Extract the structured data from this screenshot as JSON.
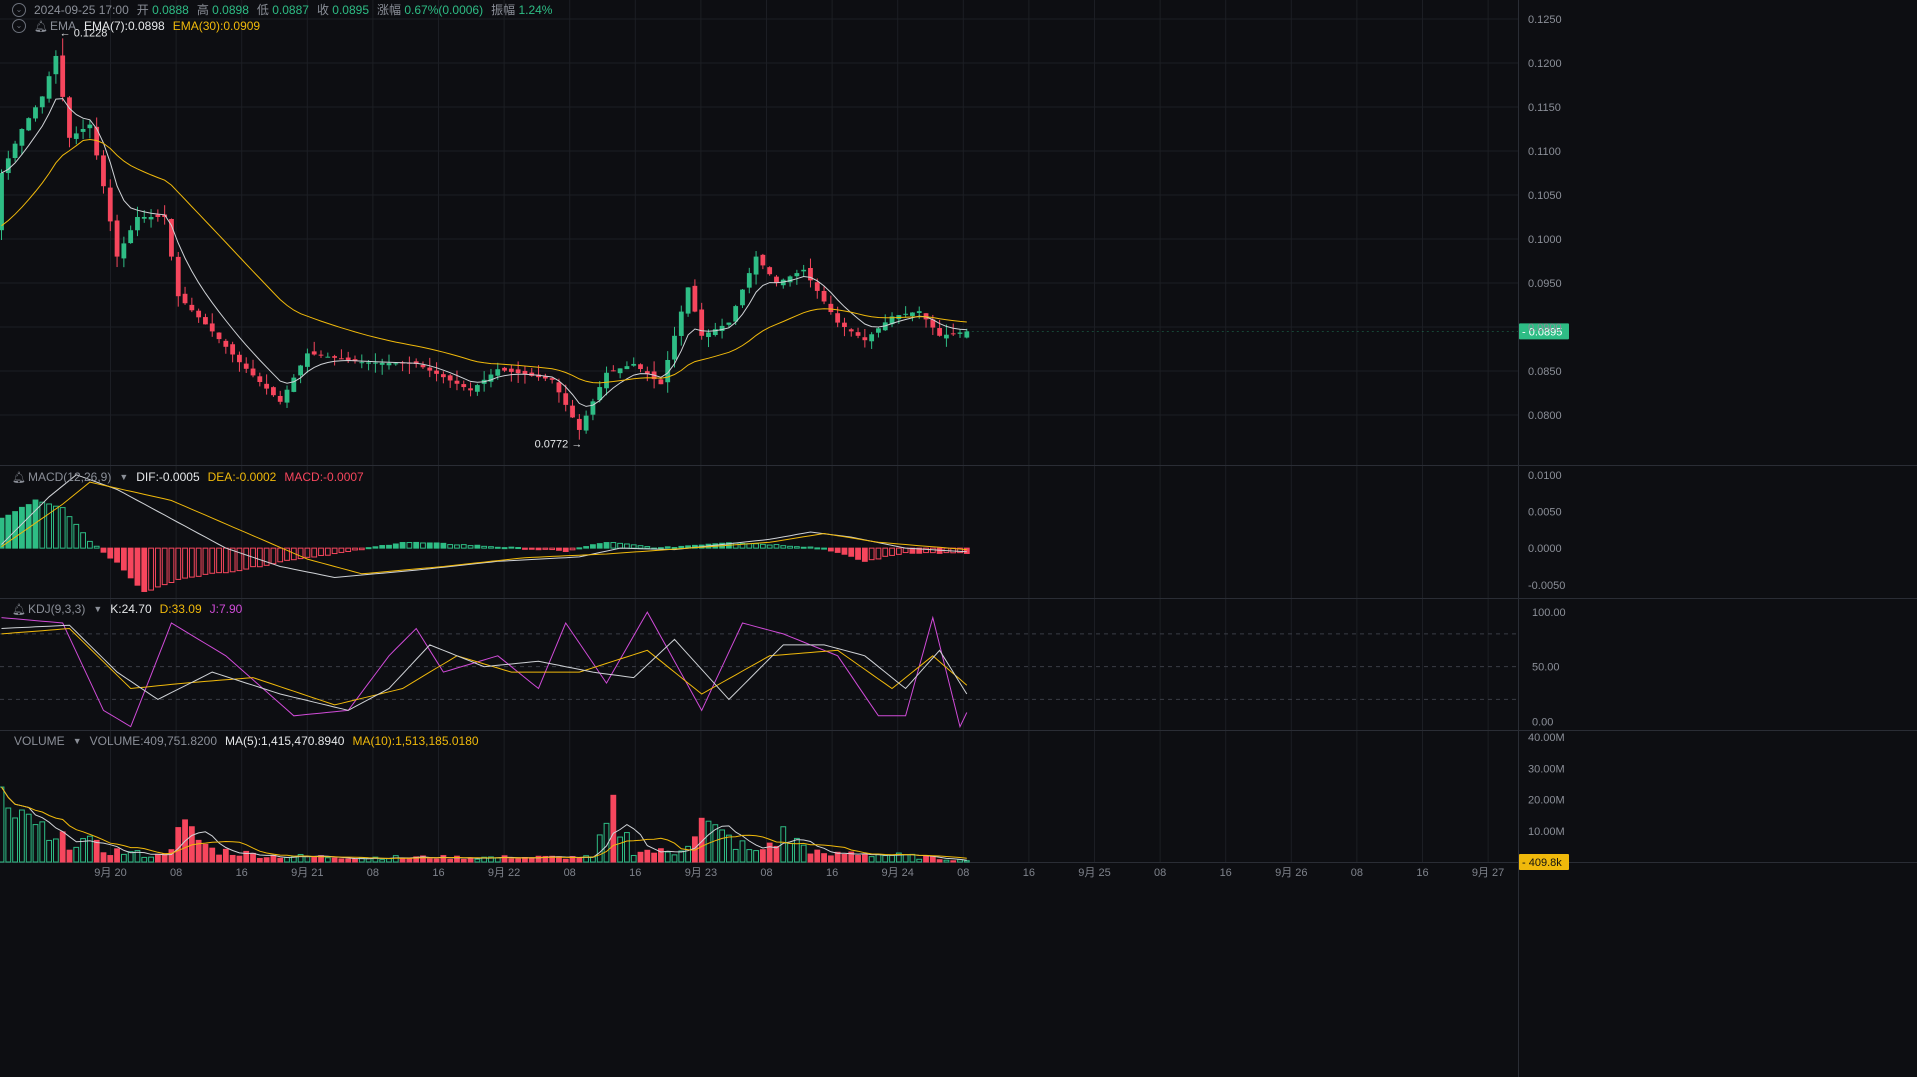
{
  "header": {
    "datetime": "2024-09-25 17:00",
    "open_label": "开",
    "open": "0.0888",
    "high_label": "高",
    "high": "0.0898",
    "low_label": "低",
    "low": "0.0887",
    "close_label": "收",
    "close": "0.0895",
    "change_label": "涨幅",
    "change": "0.67%(0.0006)",
    "amp_label": "振幅",
    "amp": "1.24%"
  },
  "ema_legend": {
    "name": "EMA",
    "ema7": "EMA(7):0.0898",
    "ema30": "EMA(30):0.0909"
  },
  "macd_legend": {
    "name": "MACD(12,26,9)",
    "dif": "DIF:-0.0005",
    "dea": "DEA:-0.0002",
    "macd": "MACD:-0.0007"
  },
  "kdj_legend": {
    "name": "KDJ(9,3,3)",
    "k": "K:24.70",
    "d": "D:33.09",
    "j": "J:7.90"
  },
  "vol_legend": {
    "name": "VOLUME",
    "vol": "VOLUME:409,751.8200",
    "ma5": "MA(5):1,415,470.8940",
    "ma10": "MA(10):1,513,185.0180"
  },
  "colors": {
    "up": "#2ebd85",
    "down": "#f6465d",
    "ema7": "#cfd2d6",
    "ema30": "#f0b90b",
    "j": "#d04bd8",
    "bg": "#0d0e12",
    "grid": "#1c1e24",
    "text": "#8b8f98"
  },
  "chart_data": [
    {
      "type": "candlestick",
      "title": "",
      "price_axis_ticks": [
        "0.1250",
        "0.1200",
        "0.1150",
        "0.1100",
        "0.1050",
        "0.1000",
        "0.0950",
        "0.0900",
        "0.0850",
        "0.0800"
      ],
      "ylim": [
        0.0753,
        0.127
      ],
      "x_axis_labels": [
        "9月 20",
        "08",
        "16",
        "9月 21",
        "08",
        "16",
        "9月 22",
        "08",
        "16",
        "9月 23",
        "08",
        "16",
        "9月 24",
        "08",
        "16",
        "9月 25",
        "08",
        "16",
        "9月 26",
        "08",
        "16",
        "9月 27"
      ],
      "candle_interval_hours": 1,
      "first_candle": "2024-09-19 19:00",
      "last_candle": "2024-09-25 17:00",
      "current_price": "0.0895",
      "max_marker": "← 0.1228",
      "min_marker": "0.0772 →",
      "ohlc_keypoints": [
        [
          "2024-09-19 19:00",
          0.101,
          0.1075
        ],
        [
          "2024-09-19 22:00",
          0.1075,
          0.1125
        ],
        [
          "2024-09-20 01:00",
          0.1125,
          0.1162
        ],
        [
          "2024-09-20 03:00",
          0.116,
          0.1208
        ],
        [
          "2024-09-20 05:00",
          0.1208,
          0.1115
        ],
        [
          "2024-09-20 08:00",
          0.1115,
          0.113
        ],
        [
          "2024-09-20 10:00",
          0.1125,
          0.106
        ],
        [
          "2024-09-20 12:00",
          0.106,
          0.098
        ],
        [
          "2024-09-20 15:00",
          0.099,
          0.1025
        ],
        [
          "2024-09-20 19:00",
          0.102,
          0.1025
        ],
        [
          "2024-09-20 21:00",
          0.1015,
          0.0935
        ],
        [
          "2024-09-21 02:00",
          0.092,
          0.0895
        ],
        [
          "2024-09-21 06:00",
          0.088,
          0.086
        ],
        [
          "2024-09-21 12:00",
          0.088,
          0.0815
        ],
        [
          "2024-09-21 16:00",
          0.086,
          0.087
        ],
        [
          "2024-09-22 00:00",
          0.0865,
          0.086
        ],
        [
          "2024-09-22 08:00",
          0.0862,
          0.0858
        ],
        [
          "2024-09-22 16:00",
          0.0848,
          0.0828
        ],
        [
          "2024-09-22 20:00",
          0.0858,
          0.0852
        ],
        [
          "2024-09-23 04:00",
          0.0846,
          0.084
        ],
        [
          "2024-09-23 08:00",
          0.083,
          0.0783
        ],
        [
          "2024-09-23 12:00",
          0.0835,
          0.0848
        ],
        [
          "2024-09-23 16:00",
          0.088,
          0.0858
        ],
        [
          "2024-09-23 20:00",
          0.0845,
          0.0835
        ],
        [
          "2024-09-24 00:00",
          0.086,
          0.0945
        ],
        [
          "2024-09-24 02:00",
          0.094,
          0.089
        ],
        [
          "2024-09-24 06:00",
          0.091,
          0.0905
        ],
        [
          "2024-09-24 10:00",
          0.0935,
          0.098
        ],
        [
          "2024-09-24 13:00",
          0.097,
          0.095
        ],
        [
          "2024-09-24 17:00",
          0.096,
          0.0965
        ],
        [
          "2024-09-24 22:00",
          0.0935,
          0.0905
        ],
        [
          "2024-09-25 02:00",
          0.088,
          0.0885
        ],
        [
          "2024-09-25 06:00",
          0.0905,
          0.0912
        ],
        [
          "2024-09-25 10:00",
          0.0915,
          0.0918
        ],
        [
          "2024-09-25 13:00",
          0.0905,
          0.089
        ],
        [
          "2024-09-25 17:00",
          0.0888,
          0.0895
        ]
      ],
      "series": [
        {
          "name": "EMA(7)"
        },
        {
          "name": "EMA(30)"
        }
      ]
    },
    {
      "type": "macd",
      "axis_ticks": [
        "0.0100",
        "0.0050",
        "0.0000",
        "-0.0050"
      ],
      "ylim": [
        -0.0068,
        0.0112
      ],
      "dif_keypoints": [
        [
          "2024-09-19 19:00",
          0.0005
        ],
        [
          "2024-09-20 02:00",
          0.007
        ],
        [
          "2024-09-20 06:00",
          0.01
        ],
        [
          "2024-09-20 12:00",
          0.008
        ],
        [
          "2024-09-20 20:00",
          0.004
        ],
        [
          "2024-09-21 04:00",
          0.0
        ],
        [
          "2024-09-21 12:00",
          -0.0025
        ],
        [
          "2024-09-21 20:00",
          -0.004
        ],
        [
          "2024-09-22 08:00",
          -0.003
        ],
        [
          "2024-09-22 20:00",
          -0.0018
        ],
        [
          "2024-09-23 08:00",
          -0.0012
        ],
        [
          "2024-09-23 14:00",
          0.0
        ],
        [
          "2024-09-23 22:00",
          -0.0002
        ],
        [
          "2024-09-24 04:00",
          0.0004
        ],
        [
          "2024-09-24 12:00",
          0.0012
        ],
        [
          "2024-09-24 18:00",
          0.0022
        ],
        [
          "2024-09-25 00:00",
          0.0015
        ],
        [
          "2024-09-25 08:00",
          0.0
        ],
        [
          "2024-09-25 17:00",
          -0.0005
        ]
      ],
      "dea_keypoints": [
        [
          "2024-09-19 19:00",
          0.0002
        ],
        [
          "2024-09-20 04:00",
          0.006
        ],
        [
          "2024-09-20 08:00",
          0.009
        ],
        [
          "2024-09-20 20:00",
          0.0065
        ],
        [
          "2024-09-21 06:00",
          0.0025
        ],
        [
          "2024-09-21 16:00",
          -0.0015
        ],
        [
          "2024-09-22 00:00",
          -0.0035
        ],
        [
          "2024-09-22 12:00",
          -0.0025
        ],
        [
          "2024-09-23 00:00",
          -0.0013
        ],
        [
          "2024-09-23 12:00",
          -0.0008
        ],
        [
          "2024-09-24 00:00",
          0.0
        ],
        [
          "2024-09-24 12:00",
          0.0008
        ],
        [
          "2024-09-24 20:00",
          0.002
        ],
        [
          "2024-09-25 04:00",
          0.0008
        ],
        [
          "2024-09-25 17:00",
          -0.0002
        ]
      ],
      "histogram_keypoints": [
        [
          "2024-09-19 19:00",
          0.004
        ],
        [
          "2024-09-20 00:00",
          0.0065
        ],
        [
          "2024-09-20 04:00",
          0.0055
        ],
        [
          "2024-09-20 08:00",
          0.001
        ],
        [
          "2024-09-20 12:00",
          -0.002
        ],
        [
          "2024-09-20 16:00",
          -0.006
        ],
        [
          "2024-09-20 22:00",
          -0.004
        ],
        [
          "2024-09-21 06:00",
          -0.003
        ],
        [
          "2024-09-21 14:00",
          -0.0015
        ],
        [
          "2024-09-21 22:00",
          -0.0005
        ],
        [
          "2024-09-22 06:00",
          0.0008
        ],
        [
          "2024-09-22 14:00",
          0.0005
        ],
        [
          "2024-09-23 06:00",
          -0.0004
        ],
        [
          "2024-09-23 12:00",
          0.0008
        ],
        [
          "2024-09-23 20:00",
          0.0
        ],
        [
          "2024-09-24 06:00",
          0.0008
        ],
        [
          "2024-09-24 14:00",
          0.0004
        ],
        [
          "2024-09-24 20:00",
          0.0
        ],
        [
          "2024-09-25 02:00",
          -0.0018
        ],
        [
          "2024-09-25 08:00",
          -0.0006
        ],
        [
          "2024-09-25 17:00",
          -0.0007
        ]
      ]
    },
    {
      "type": "kdj",
      "axis_ticks": [
        "100.00",
        "50.00",
        "0.00"
      ],
      "ylim": [
        -8,
        112
      ],
      "reference_lines": [
        80,
        50,
        20
      ],
      "k_keypoints": [
        [
          "2024-09-19 19:00",
          85
        ],
        [
          "2024-09-20 05:00",
          88
        ],
        [
          "2024-09-20 12:00",
          45
        ],
        [
          "2024-09-20 18:00",
          20
        ],
        [
          "2024-09-21 02:00",
          45
        ],
        [
          "2024-09-21 12:00",
          25
        ],
        [
          "2024-09-21 22:00",
          10
        ],
        [
          "2024-09-22 04:00",
          30
        ],
        [
          "2024-09-22 10:00",
          70
        ],
        [
          "2024-09-22 18:00",
          50
        ],
        [
          "2024-09-23 02:00",
          55
        ],
        [
          "2024-09-23 10:00",
          45
        ],
        [
          "2024-09-23 16:00",
          40
        ],
        [
          "2024-09-23 22:00",
          75
        ],
        [
          "2024-09-24 06:00",
          20
        ],
        [
          "2024-09-24 14:00",
          70
        ],
        [
          "2024-09-24 20:00",
          70
        ],
        [
          "2024-09-25 02:00",
          60
        ],
        [
          "2024-09-25 08:00",
          30
        ],
        [
          "2024-09-25 13:00",
          65
        ],
        [
          "2024-09-25 17:00",
          25
        ]
      ],
      "d_keypoints": [
        [
          "2024-09-19 19:00",
          80
        ],
        [
          "2024-09-20 05:00",
          85
        ],
        [
          "2024-09-20 14:00",
          30
        ],
        [
          "2024-09-20 22:00",
          35
        ],
        [
          "2024-09-21 08:00",
          40
        ],
        [
          "2024-09-21 20:00",
          15
        ],
        [
          "2024-09-22 06:00",
          30
        ],
        [
          "2024-09-22 14:00",
          60
        ],
        [
          "2024-09-22 22:00",
          45
        ],
        [
          "2024-09-23 08:00",
          45
        ],
        [
          "2024-09-23 18:00",
          65
        ],
        [
          "2024-09-24 02:00",
          25
        ],
        [
          "2024-09-24 12:00",
          60
        ],
        [
          "2024-09-24 22:00",
          65
        ],
        [
          "2024-09-25 06:00",
          30
        ],
        [
          "2024-09-25 12:00",
          60
        ],
        [
          "2024-09-25 17:00",
          33
        ]
      ],
      "j_keypoints": [
        [
          "2024-09-19 19:00",
          95
        ],
        [
          "2024-09-20 04:00",
          90
        ],
        [
          "2024-09-20 10:00",
          10
        ],
        [
          "2024-09-20 14:00",
          -5
        ],
        [
          "2024-09-20 20:00",
          90
        ],
        [
          "2024-09-21 04:00",
          60
        ],
        [
          "2024-09-21 14:00",
          5
        ],
        [
          "2024-09-21 22:00",
          10
        ],
        [
          "2024-09-22 04:00",
          60
        ],
        [
          "2024-09-22 08:00",
          85
        ],
        [
          "2024-09-22 12:00",
          45
        ],
        [
          "2024-09-22 20:00",
          60
        ],
        [
          "2024-09-23 02:00",
          30
        ],
        [
          "2024-09-23 06:00",
          90
        ],
        [
          "2024-09-23 12:00",
          35
        ],
        [
          "2024-09-23 18:00",
          100
        ],
        [
          "2024-09-24 02:00",
          10
        ],
        [
          "2024-09-24 08:00",
          90
        ],
        [
          "2024-09-24 14:00",
          80
        ],
        [
          "2024-09-24 22:00",
          60
        ],
        [
          "2024-09-25 04:00",
          5
        ],
        [
          "2024-09-25 08:00",
          5
        ],
        [
          "2024-09-25 12:00",
          95
        ],
        [
          "2024-09-25 16:00",
          -5
        ],
        [
          "2024-09-25 17:00",
          8
        ]
      ]
    },
    {
      "type": "bar",
      "name": "volume",
      "axis_ticks": [
        "40.00M",
        "30.00M",
        "20.00M",
        "10.00M"
      ],
      "ylim": [
        0,
        42
      ],
      "unit": "M",
      "current_volume_tag": "409.8k",
      "volume_keypoints_millions": [
        [
          "2024-09-19 19:00",
          22
        ],
        [
          "2024-09-19 21:00",
          12
        ],
        [
          "2024-09-20 00:00",
          14
        ],
        [
          "2024-09-20 02:00",
          6
        ],
        [
          "2024-09-20 06:00",
          8
        ],
        [
          "2024-09-20 10:00",
          4
        ],
        [
          "2024-09-20 14:00",
          3
        ],
        [
          "2024-09-20 18:00",
          2
        ],
        [
          "2024-09-20 22:00",
          11
        ],
        [
          "2024-09-21 02:00",
          4
        ],
        [
          "2024-09-21 10:00",
          2
        ],
        [
          "2024-09-22 00:00",
          1.5
        ],
        [
          "2024-09-22 12:00",
          1.5
        ],
        [
          "2024-09-23 00:00",
          1.5
        ],
        [
          "2024-09-23 10:00",
          1.5
        ],
        [
          "2024-09-23 13:00",
          16
        ],
        [
          "2024-09-23 16:00",
          4
        ],
        [
          "2024-09-23 22:00",
          3
        ],
        [
          "2024-09-24 02:00",
          13
        ],
        [
          "2024-09-24 04:00",
          10
        ],
        [
          "2024-09-24 10:00",
          3
        ],
        [
          "2024-09-24 14:00",
          9
        ],
        [
          "2024-09-24 20:00",
          2
        ],
        [
          "2024-09-25 00:00",
          3
        ],
        [
          "2024-09-25 08:00",
          2
        ],
        [
          "2024-09-25 17:00",
          0.41
        ]
      ],
      "ma_series": [
        {
          "name": "MA(5)"
        },
        {
          "name": "MA(10)"
        }
      ]
    }
  ]
}
